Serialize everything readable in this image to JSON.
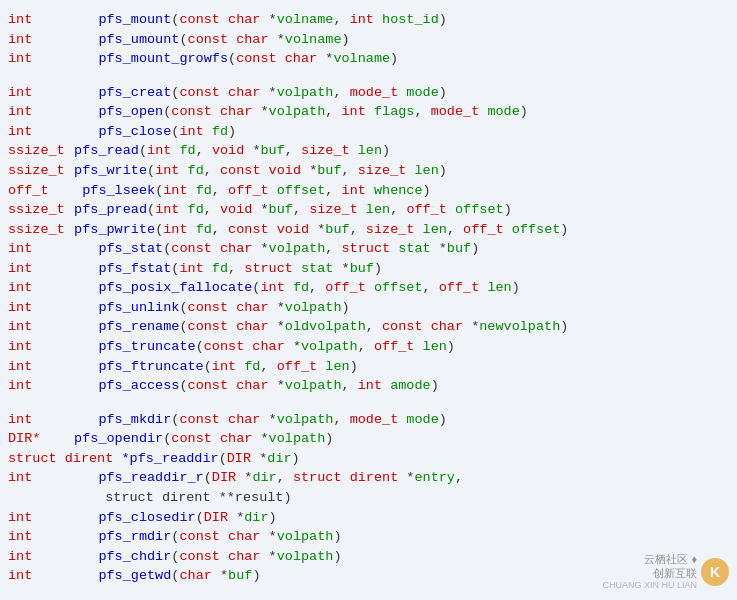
{
  "lines": [
    {
      "type": "int",
      "indent": "    ",
      "content": "pfs_mount",
      "params": "(const char *volname, int host_id)"
    },
    {
      "type": "int",
      "indent": "    ",
      "content": "pfs_umount",
      "params": "(const char *volname)"
    },
    {
      "type": "int",
      "indent": "    ",
      "content": "pfs_mount_growfs",
      "params": "(const char *volname)"
    },
    {
      "type": "spacer"
    },
    {
      "type": "int",
      "indent": "    ",
      "content": "pfs_creat",
      "params": "(const char *volpath, mode_t mode)"
    },
    {
      "type": "int",
      "indent": "    ",
      "content": "pfs_open",
      "params": "(const char *volpath, int flags, mode_t mode)"
    },
    {
      "type": "int",
      "indent": "    ",
      "content": "pfs_close",
      "params": "(int fd)"
    },
    {
      "type": "ssize_t",
      "indent": " ",
      "content": "pfs_read",
      "params": "(int fd, void *buf, size_t len)"
    },
    {
      "type": "ssize_t",
      "indent": " ",
      "content": "pfs_write",
      "params": "(int fd, const void *buf, size_t len)"
    },
    {
      "type": "off_t",
      "indent": "  ",
      "content": "pfs_lseek",
      "params": "(int fd, off_t offset, int whence)"
    },
    {
      "type": "ssize_t",
      "indent": " ",
      "content": "pfs_pread",
      "params": "(int fd, void *buf, size_t len, off_t offset)"
    },
    {
      "type": "ssize_t",
      "indent": " ",
      "content": "pfs_pwrite",
      "params": "(int fd, const void *buf, size_t len, off_t offset)"
    },
    {
      "type": "int",
      "indent": "    ",
      "content": "pfs_stat",
      "params": "(const char *volpath, struct stat *buf)"
    },
    {
      "type": "int",
      "indent": "    ",
      "content": "pfs_fstat",
      "params": "(int fd, struct stat *buf)"
    },
    {
      "type": "int",
      "indent": "    ",
      "content": "pfs_posix_fallocate",
      "params": "(int fd, off_t offset, off_t len)"
    },
    {
      "type": "int",
      "indent": "    ",
      "content": "pfs_unlink",
      "params": "(const char *volpath)"
    },
    {
      "type": "int",
      "indent": "    ",
      "content": "pfs_rename",
      "params": "(const char *oldvolpath, const char *newvolpath)"
    },
    {
      "type": "int",
      "indent": "    ",
      "content": "pfs_truncate",
      "params": "(const char *volpath, off_t len)"
    },
    {
      "type": "int",
      "indent": "    ",
      "content": "pfs_ftruncate",
      "params": "(int fd, off_t len)"
    },
    {
      "type": "int",
      "indent": "    ",
      "content": "pfs_access",
      "params": "(const char *volpath, int amode)"
    },
    {
      "type": "spacer"
    },
    {
      "type": "int",
      "indent": "    ",
      "content": "pfs_mkdir",
      "params": "(const char *volpath, mode_t mode)"
    },
    {
      "type": "DIR*",
      "indent": " ",
      "content": "pfs_opendir",
      "params": "(const char *volpath)"
    },
    {
      "type": "struct dirent",
      "indent": " ",
      "content": "*pfs_readdir",
      "params": "(DIR *dir)"
    },
    {
      "type": "int",
      "indent": "    ",
      "content": "pfs_readdir_r",
      "params": "(DIR *dir, struct dirent *entry,"
    },
    {
      "type": "continuation",
      "indent": "            ",
      "content": "struct dirent **result)"
    },
    {
      "type": "int",
      "indent": "    ",
      "content": "pfs_closedir",
      "params": "(DIR *dir)"
    },
    {
      "type": "int",
      "indent": "    ",
      "content": "pfs_rmdir",
      "params": "(const char *volpath)"
    },
    {
      "type": "int",
      "indent": "    ",
      "content": "pfs_chdir",
      "params": "(const char *volpath)"
    },
    {
      "type": "int",
      "indent": "    ",
      "content": "pfs_getwd",
      "params": "(char *buf)"
    }
  ],
  "watermark": {
    "line1": "云栖社区 ♦",
    "line2": "CHUANG XIN HU LIAN",
    "logo": "K"
  }
}
